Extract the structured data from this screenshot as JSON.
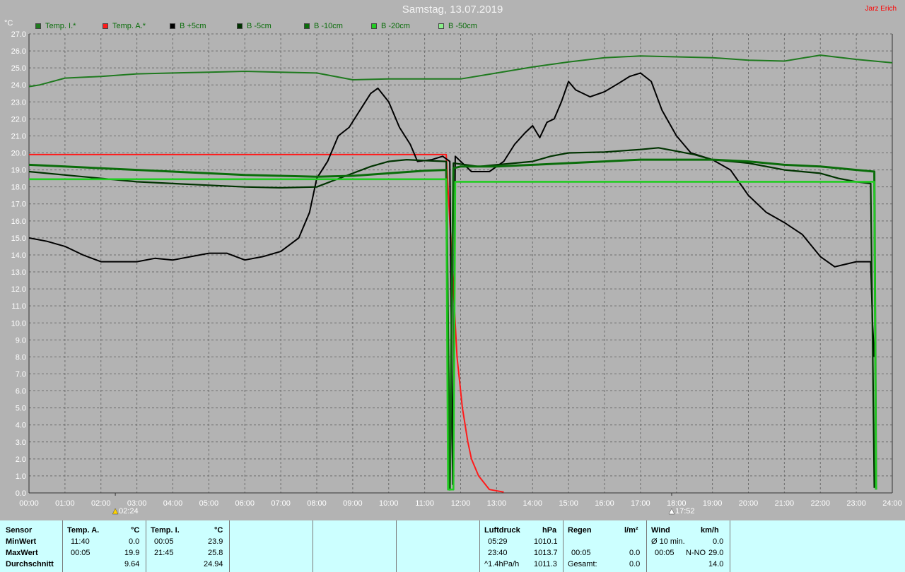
{
  "header": {
    "title": "Samstag, 13.07.2019",
    "author": "Jarz Erich"
  },
  "legend": [
    {
      "label": "Temp. I.*",
      "color": "#1f7a1f"
    },
    {
      "label": "Temp. A.*",
      "color": "#ff1a1a"
    },
    {
      "label": "B +5cm",
      "color": "#000000"
    },
    {
      "label": "B -5cm",
      "color": "#003300"
    },
    {
      "label": "B -10cm",
      "color": "#0a6d0a"
    },
    {
      "label": "B -20cm",
      "color": "#22cc22"
    },
    {
      "label": "B -50cm",
      "color": "#88ee88"
    }
  ],
  "markers": {
    "sunrise": "02:24",
    "sunset": "17:52"
  },
  "footer": {
    "sensor_label": "Sensor",
    "min_label": "MinWert",
    "max_label": "MaxWert",
    "avg_label": "Durchschnitt",
    "temp_a": {
      "title": "Temp. A.",
      "unit": "°C",
      "min_time": "11:40",
      "min_val": "0.0",
      "max_time": "00:05",
      "max_val": "19.9",
      "avg": "9.64"
    },
    "temp_i": {
      "title": "Temp. I.",
      "unit": "°C",
      "min_time": "00:05",
      "min_val": "23.9",
      "max_time": "21:45",
      "max_val": "25.8",
      "avg": "24.94"
    },
    "luftdruck": {
      "title": "Luftdruck",
      "unit": "hPa",
      "min_time": "05:29",
      "min_val": "1010.1",
      "max_time": "23:40",
      "max_val": "1013.7",
      "trend": "^1.4hPa/h",
      "avg": "1011.3"
    },
    "regen": {
      "title": "Regen",
      "unit": "l/m²",
      "max_time": "00:05",
      "max_val": "0.0",
      "total_label": "Gesamt:",
      "total": "0.0"
    },
    "wind": {
      "title": "Wind",
      "unit": "km/h",
      "avg10_label": "Ø 10 min.",
      "avg10": "0.0",
      "max_time": "00:05",
      "max_dir": "N-NO",
      "max_val": "29.0",
      "avg": "14.0"
    }
  },
  "chart_data": {
    "type": "line",
    "ylabel": "°C",
    "ylim": [
      0,
      27
    ],
    "xlim": [
      0,
      24
    ],
    "xticks": [
      "00:00",
      "01:00",
      "02:00",
      "03:00",
      "04:00",
      "05:00",
      "06:00",
      "07:00",
      "08:00",
      "09:00",
      "10:00",
      "11:00",
      "12:00",
      "13:00",
      "14:00",
      "15:00",
      "16:00",
      "17:00",
      "18:00",
      "19:00",
      "20:00",
      "21:00",
      "22:00",
      "23:00",
      "24:00"
    ],
    "yticks": [
      "0.0",
      "1.0",
      "2.0",
      "3.0",
      "4.0",
      "5.0",
      "6.0",
      "7.0",
      "8.0",
      "9.0",
      "10.0",
      "11.0",
      "12.0",
      "13.0",
      "14.0",
      "15.0",
      "16.0",
      "17.0",
      "18.0",
      "19.0",
      "20.0",
      "21.0",
      "22.0",
      "23.0",
      "24.0",
      "25.0",
      "26.0",
      "27.0"
    ],
    "grid": true,
    "series": [
      {
        "name": "Temp. I.*",
        "color": "#1f7a1f",
        "width": 2,
        "points": [
          [
            0,
            23.9
          ],
          [
            0.3,
            24.0
          ],
          [
            1,
            24.4
          ],
          [
            2,
            24.5
          ],
          [
            3,
            24.65
          ],
          [
            4,
            24.7
          ],
          [
            5,
            24.75
          ],
          [
            6,
            24.8
          ],
          [
            7,
            24.75
          ],
          [
            8,
            24.7
          ],
          [
            9,
            24.3
          ],
          [
            10,
            24.35
          ],
          [
            11,
            24.35
          ],
          [
            12,
            24.35
          ],
          [
            13,
            24.7
          ],
          [
            14,
            25.05
          ],
          [
            15,
            25.35
          ],
          [
            16,
            25.6
          ],
          [
            17,
            25.7
          ],
          [
            18,
            25.65
          ],
          [
            19,
            25.6
          ],
          [
            20,
            25.45
          ],
          [
            21,
            25.4
          ],
          [
            22,
            25.75
          ],
          [
            23,
            25.5
          ],
          [
            24,
            25.3
          ]
        ]
      },
      {
        "name": "Temp. A.*",
        "color": "#ff1a1a",
        "width": 2,
        "points": [
          [
            0,
            19.9
          ],
          [
            11.6,
            19.9
          ],
          [
            11.7,
            16.0
          ],
          [
            11.8,
            12.0
          ],
          [
            11.9,
            8.0
          ],
          [
            12.05,
            5.0
          ],
          [
            12.2,
            3.0
          ],
          [
            12.3,
            2.0
          ],
          [
            12.5,
            1.0
          ],
          [
            12.8,
            0.2
          ],
          [
            13.2,
            0.05
          ]
        ]
      },
      {
        "name": "B +5cm",
        "color": "#000000",
        "width": 2,
        "points": [
          [
            0,
            15.0
          ],
          [
            0.5,
            14.8
          ],
          [
            1,
            14.5
          ],
          [
            1.5,
            14.0
          ],
          [
            2,
            13.6
          ],
          [
            3,
            13.6
          ],
          [
            3.5,
            13.8
          ],
          [
            4,
            13.7
          ],
          [
            5,
            14.1
          ],
          [
            5.5,
            14.1
          ],
          [
            6,
            13.7
          ],
          [
            6.5,
            13.9
          ],
          [
            7,
            14.2
          ],
          [
            7.5,
            15.0
          ],
          [
            7.8,
            16.5
          ],
          [
            8.0,
            18.5
          ],
          [
            8.3,
            19.5
          ],
          [
            8.6,
            21.0
          ],
          [
            8.9,
            21.5
          ],
          [
            9.2,
            22.5
          ],
          [
            9.5,
            23.5
          ],
          [
            9.7,
            23.8
          ],
          [
            10,
            23.0
          ],
          [
            10.3,
            21.5
          ],
          [
            10.6,
            20.5
          ],
          [
            10.8,
            19.5
          ],
          [
            11.2,
            19.6
          ],
          [
            11.5,
            19.8
          ],
          [
            11.7,
            19.5
          ],
          [
            11.78,
            0.5
          ],
          [
            11.85,
            19.8
          ],
          [
            12.3,
            18.9
          ],
          [
            12.8,
            18.9
          ],
          [
            13.2,
            19.5
          ],
          [
            13.5,
            20.5
          ],
          [
            13.8,
            21.2
          ],
          [
            14.0,
            21.6
          ],
          [
            14.2,
            20.9
          ],
          [
            14.4,
            21.8
          ],
          [
            14.6,
            22.0
          ],
          [
            14.8,
            23.0
          ],
          [
            15.0,
            24.2
          ],
          [
            15.2,
            23.7
          ],
          [
            15.6,
            23.3
          ],
          [
            16,
            23.6
          ],
          [
            16.4,
            24.1
          ],
          [
            16.7,
            24.5
          ],
          [
            17.0,
            24.7
          ],
          [
            17.3,
            24.2
          ],
          [
            17.6,
            22.5
          ],
          [
            18.0,
            21.0
          ],
          [
            18.4,
            20.0
          ],
          [
            19,
            19.6
          ],
          [
            19.5,
            19.0
          ],
          [
            20,
            17.5
          ],
          [
            20.5,
            16.5
          ],
          [
            21,
            15.9
          ],
          [
            21.5,
            15.2
          ],
          [
            22,
            13.9
          ],
          [
            22.4,
            13.3
          ],
          [
            22.6,
            13.4
          ],
          [
            23,
            13.6
          ],
          [
            23.4,
            13.6
          ],
          [
            23.45,
            10.0
          ],
          [
            23.5,
            8.0
          ]
        ]
      },
      {
        "name": "B -5cm",
        "color": "#003300",
        "width": 2.2,
        "points": [
          [
            0,
            18.9
          ],
          [
            1,
            18.7
          ],
          [
            2,
            18.5
          ],
          [
            3,
            18.3
          ],
          [
            4,
            18.2
          ],
          [
            5,
            18.1
          ],
          [
            6,
            18.0
          ],
          [
            7,
            17.95
          ],
          [
            8,
            18.0
          ],
          [
            8.5,
            18.4
          ],
          [
            9,
            18.8
          ],
          [
            9.5,
            19.2
          ],
          [
            10,
            19.5
          ],
          [
            10.5,
            19.6
          ],
          [
            11,
            19.55
          ],
          [
            11.6,
            19.5
          ],
          [
            11.7,
            0.3
          ],
          [
            11.8,
            19.4
          ],
          [
            12.5,
            19.2
          ],
          [
            13,
            19.3
          ],
          [
            14,
            19.5
          ],
          [
            14.5,
            19.8
          ],
          [
            15,
            20.0
          ],
          [
            16,
            20.05
          ],
          [
            17,
            20.2
          ],
          [
            17.5,
            20.3
          ],
          [
            18,
            20.1
          ],
          [
            18.5,
            19.9
          ],
          [
            19,
            19.6
          ],
          [
            20,
            19.4
          ],
          [
            21,
            19.0
          ],
          [
            22,
            18.8
          ],
          [
            22.5,
            18.5
          ],
          [
            23,
            18.3
          ],
          [
            23.4,
            18.2
          ],
          [
            23.5,
            0.3
          ]
        ]
      },
      {
        "name": "B -10cm",
        "color": "#0a6d0a",
        "width": 3,
        "points": [
          [
            0,
            19.3
          ],
          [
            1,
            19.2
          ],
          [
            2,
            19.1
          ],
          [
            3,
            19.0
          ],
          [
            4,
            18.9
          ],
          [
            5,
            18.8
          ],
          [
            6,
            18.7
          ],
          [
            7,
            18.65
          ],
          [
            8,
            18.6
          ],
          [
            9,
            18.65
          ],
          [
            10,
            18.8
          ],
          [
            11,
            18.95
          ],
          [
            11.6,
            19.0
          ],
          [
            11.7,
            0.2
          ],
          [
            11.8,
            19.1
          ],
          [
            12,
            19.2
          ],
          [
            13,
            19.2
          ],
          [
            14,
            19.3
          ],
          [
            15,
            19.4
          ],
          [
            16,
            19.5
          ],
          [
            17,
            19.6
          ],
          [
            18,
            19.6
          ],
          [
            19,
            19.6
          ],
          [
            20,
            19.5
          ],
          [
            21,
            19.3
          ],
          [
            22,
            19.2
          ],
          [
            23,
            19.0
          ],
          [
            23.5,
            18.9
          ],
          [
            23.55,
            0.2
          ]
        ]
      },
      {
        "name": "B -20cm",
        "color": "#22cc22",
        "width": 2.6,
        "points": [
          [
            0,
            18.45
          ],
          [
            11.6,
            18.45
          ],
          [
            11.65,
            0.2
          ],
          [
            11.8,
            0.2
          ],
          [
            11.85,
            18.3
          ],
          [
            23.5,
            18.3
          ],
          [
            23.55,
            0.2
          ]
        ]
      }
    ]
  }
}
